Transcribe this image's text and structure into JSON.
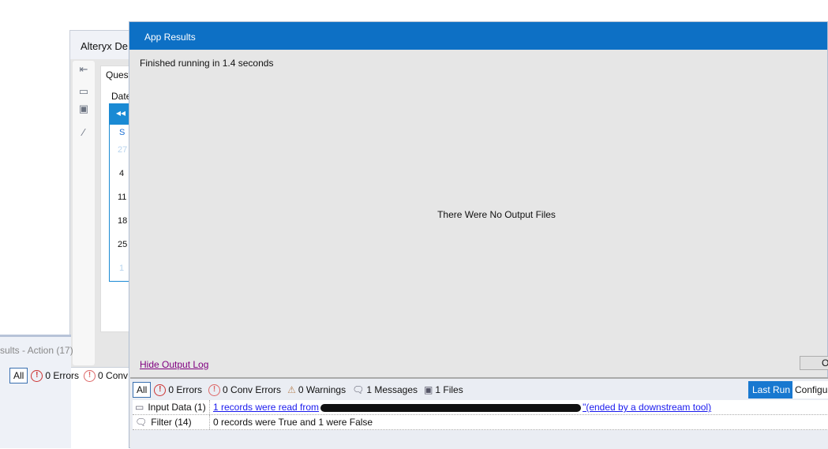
{
  "back_window": {
    "title": "Alteryx De",
    "tab": "Quest",
    "date_label": "Date",
    "calendar": {
      "nav": "◂◂",
      "day_header": "S",
      "days": [
        "27",
        "4",
        "11",
        "18",
        "25",
        "1"
      ]
    }
  },
  "left_results": {
    "title": "sults - Action (17)",
    "all": "All",
    "errors": "0 Errors",
    "conv": "0 Conv"
  },
  "dialog": {
    "title": "App Results",
    "finished": "Finished running in 1.4 seconds",
    "no_output": "There Were No Output Files",
    "hide_log": "Hide Output Log",
    "ok": "O"
  },
  "log": {
    "all": "All",
    "errors": "0 Errors",
    "conv_errors": "0 Conv Errors",
    "warnings": "0 Warnings",
    "messages": "1 Messages",
    "files": "1 Files",
    "last_run": "Last Run",
    "configure": "Configu",
    "rows": [
      {
        "tool": "Input Data (1)",
        "msg_start": "1 records were read from",
        "msg_end": "\"(ended by a downstream tool)"
      },
      {
        "tool": "Filter (14)",
        "msg": "0 records were True and 1 were False"
      }
    ]
  }
}
